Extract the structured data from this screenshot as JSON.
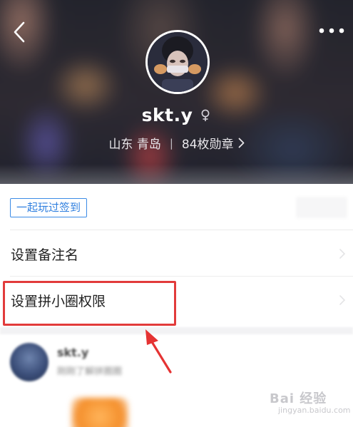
{
  "header": {
    "back_icon": "chevron-left-icon",
    "more_icon": "more-dots-icon",
    "avatar_alt": "user-avatar",
    "username": "skt.y",
    "gender_icon": "female-icon",
    "location": "山东 青岛",
    "separator": "|",
    "badges_text": "84枚勋章",
    "badges_chevron": "chevron-right-icon"
  },
  "tag": {
    "label": "一起玩过签到"
  },
  "menu": {
    "items": [
      {
        "label": "设置备注名"
      },
      {
        "label": "设置拼小圈权限"
      }
    ]
  },
  "preview": {
    "name": "skt.y",
    "subtitle": "刚刚了解拼圈圈"
  },
  "watermark": {
    "brand": "Bai 经验",
    "url": "jingyan.baidu.com"
  },
  "colors": {
    "accent_blue": "#2f7fdf",
    "highlight_red": "#e23b3b",
    "text_primary": "#1f1f1f",
    "divider": "#ececec"
  }
}
